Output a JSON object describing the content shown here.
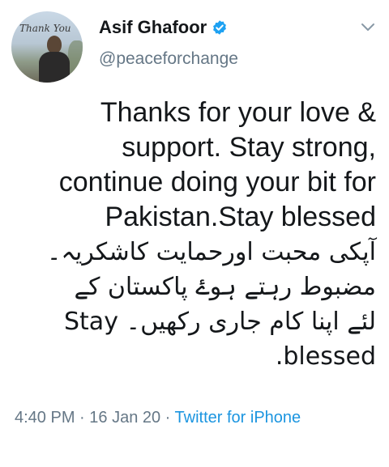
{
  "author": {
    "name": "Asif Ghafoor",
    "handle": "@peaceforchange",
    "avatar_caption": "Thank You",
    "verified_icon": "verified-badge-icon",
    "verified_color": "#1da1f2"
  },
  "tweet": {
    "lines": [
      {
        "text": "Thanks for your love &",
        "lang": "en"
      },
      {
        "text": "support. Stay strong,",
        "lang": "en"
      },
      {
        "text": "continue doing your bit for",
        "lang": "en"
      },
      {
        "text": "Pakistan.Stay blessed",
        "lang": "en"
      },
      {
        "text": "آپکی محبت اورحمایت کاشکریہ۔",
        "lang": "ur"
      },
      {
        "text": "مضبوط رہتے ہوۓ پاکستان کے",
        "lang": "ur"
      },
      {
        "text": "لئے اپنا کام جاری رکھیں۔ Stay",
        "lang": "ur"
      },
      {
        "text": "blessed.",
        "lang": "ur"
      }
    ]
  },
  "meta": {
    "time": "4:40 PM",
    "separator": " · ",
    "date": "16 Jan 20",
    "source": "Twitter for iPhone"
  },
  "colors": {
    "text": "#14171a",
    "secondary": "#657786",
    "link": "#1b95e0"
  }
}
